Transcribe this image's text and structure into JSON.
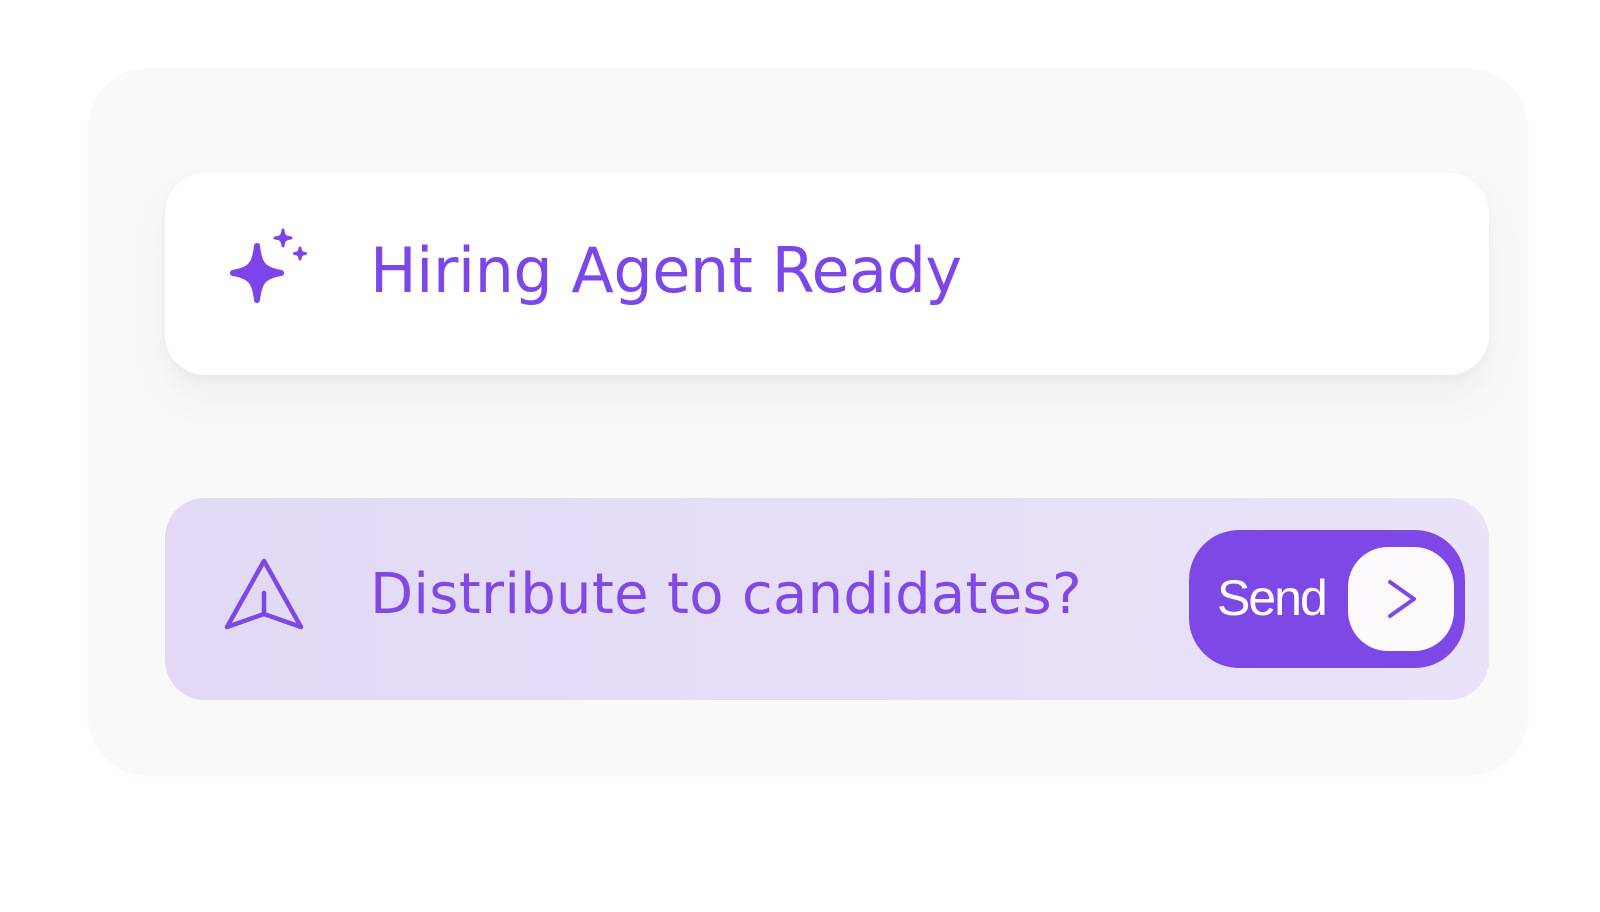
{
  "status": {
    "title": "Hiring Agent Ready",
    "icon": "sparkle-icon"
  },
  "action": {
    "prompt": "Distribute to candidates?",
    "icon": "send-arrow-icon",
    "button_label": "Send",
    "button_icon": "chevron-right-icon"
  },
  "colors": {
    "accent": "#7e48e6",
    "action_background": "#e4dcf6",
    "card_background": "#ffffff",
    "outer_background": "#faf9fa"
  }
}
